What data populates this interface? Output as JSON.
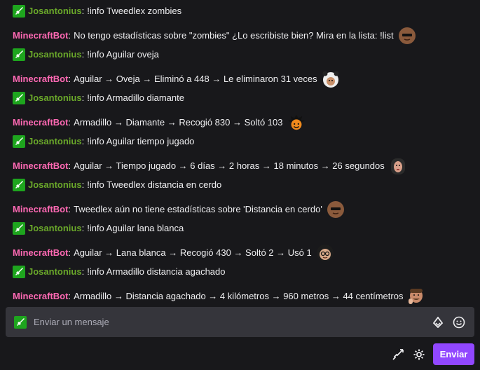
{
  "chat": {
    "messages": [
      {
        "user": "Josantonius",
        "text": "!info Tweedlex zombies",
        "badge": "sword-badge",
        "user_color": "#6aa82a"
      },
      {
        "user": "MinecraftBot",
        "text": "No tengo estadísticas sobre \"zombies\" ¿Lo escribiste bien? Mira en la lista: !list",
        "user_color": "#ff69b4",
        "emote": "sunglasses-face-emote"
      },
      {
        "user": "Josantonius",
        "text": "!info Aguilar oveja",
        "badge": "sword-badge",
        "user_color": "#6aa82a"
      },
      {
        "user": "MinecraftBot",
        "text": "Aguilar → Oveja → Eliminó a 448 → Le eliminaron 31 veces",
        "user_color": "#ff69b4",
        "emote": "panda-hat-face-emote"
      },
      {
        "user": "Josantonius",
        "text": "!info Armadillo diamante",
        "badge": "sword-badge",
        "user_color": "#6aa82a"
      },
      {
        "user": "MinecraftBot",
        "text": "Armadillo → Diamante → Recogió 830 → Soltó 103",
        "user_color": "#ff69b4",
        "emote": "spiky-hair-cartoon-emote"
      },
      {
        "user": "Josantonius",
        "text": "!info Aguilar tiempo jugado",
        "badge": "sword-badge",
        "user_color": "#6aa82a"
      },
      {
        "user": "MinecraftBot",
        "text": "Aguilar → Tiempo jugado → 6 días → 2 horas → 18 minutos → 26 segundos",
        "user_color": "#ff69b4",
        "emote": "long-hair-face-emote"
      },
      {
        "user": "Josantonius",
        "text": "!info Tweedlex distancia en cerdo",
        "badge": "sword-badge",
        "user_color": "#6aa82a"
      },
      {
        "user": "MinecraftBot",
        "text": "Tweedlex aún no tiene estadísticas sobre 'Distancia en cerdo'",
        "user_color": "#ff69b4",
        "emote": "sunglasses-face-emote"
      },
      {
        "user": "Josantonius",
        "text": "!info Aguilar lana blanca",
        "badge": "sword-badge",
        "user_color": "#6aa82a"
      },
      {
        "user": "MinecraftBot",
        "text": "Aguilar → Lana blanca → Recogió 430 → Soltó 2 → Usó 1",
        "user_color": "#ff69b4",
        "emote": "glasses-face-emote"
      },
      {
        "user": "Josantonius",
        "text": "!info Armadillo distancia agachado",
        "badge": "sword-badge",
        "user_color": "#6aa82a"
      },
      {
        "user": "MinecraftBot",
        "text": "Armadillo → Distancia agachado → 4 kilómetros → 960 metros → 44 centímetros",
        "user_color": "#ff69b4",
        "emote": "thinking-man-emote"
      }
    ]
  },
  "input": {
    "placeholder": "Enviar un mensaje",
    "icons": [
      "sword-badge-icon",
      "bits-icon",
      "emote-picker-icon"
    ]
  },
  "footer": {
    "icons": [
      "sword-icon",
      "settings-gear-icon"
    ],
    "send_label": "Enviar"
  },
  "colors": {
    "background": "#18181b",
    "input_background": "#35353b",
    "accent": "#9147ff",
    "badge_green": "#1ea51e"
  }
}
